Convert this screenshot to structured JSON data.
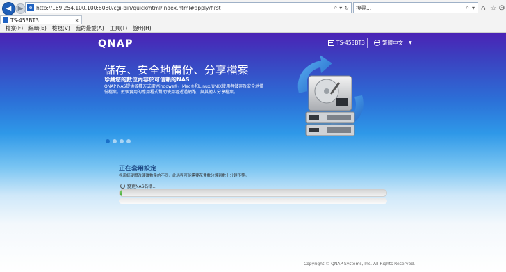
{
  "browser": {
    "address_url": "http://169.254.100.100:8080/cgi-bin/quick/html/index.html#apply/first",
    "search_placeholder": "搜尋...",
    "tab_label": "TS-453BT3",
    "menu": [
      "檔案(F)",
      "編輯(E)",
      "檢視(V)",
      "我的最愛(A)",
      "工具(T)",
      "說明(H)"
    ]
  },
  "header": {
    "logo": "QNAP",
    "model": "TS-453BT3",
    "language": "繁體中文"
  },
  "hero": {
    "title": "儲存、安全地備份、分享檔案",
    "subtitle": "珍藏您的數位內容於可信賴的NAS",
    "description": "QNAP NAS提供各種方式讓Windows®、Mac®和Linux/UNIX使用者儲存及安全地備份檔案。數個實用的應用程式幫助使用者透過網路，與其他人分享檔案。",
    "carousel_count": 4,
    "carousel_active": 0
  },
  "setup": {
    "title": "正在套用設定",
    "description": "視系統硬體及硬碟數量的不同，此過程可能需要花費數分鐘到數十分鐘不等。",
    "status": "變更NAS名稱...",
    "progress_fraction": 0.01
  },
  "footer": {
    "copyright": "Copyright © QNAP Systems, Inc. All Rights Reserved."
  },
  "colors": {
    "brand_purple": "#4b22b5",
    "brand_blue": "#2e98e8",
    "progress_green": "#46a83a",
    "setup_title": "#1e4a86"
  }
}
